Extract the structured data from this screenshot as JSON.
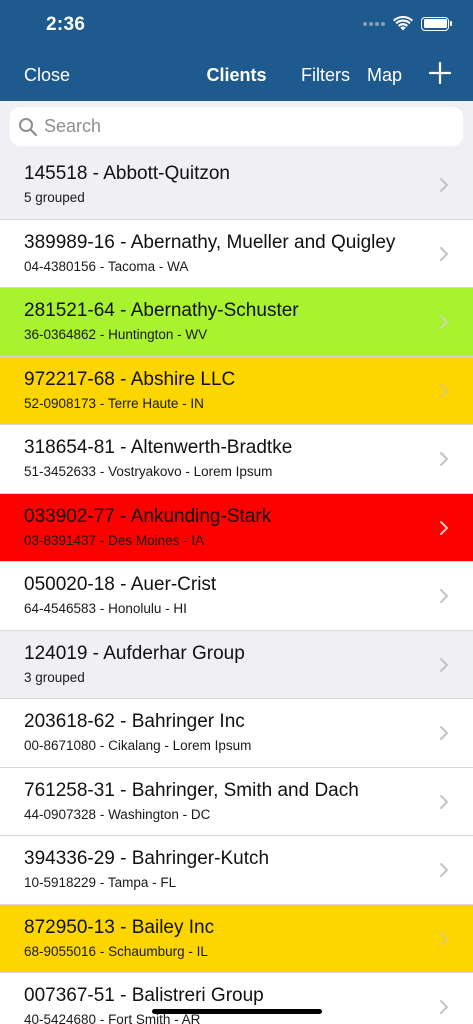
{
  "status_bar": {
    "time": "2:36"
  },
  "nav": {
    "close_label": "Close",
    "title": "Clients",
    "filters_label": "Filters",
    "map_label": "Map",
    "add_icon": "plus-icon"
  },
  "search": {
    "placeholder": "Search",
    "value": ""
  },
  "colors": {
    "header": "#1f5a8f",
    "grouped": "#efeff4",
    "default": "#ffffff",
    "green": "#a8f22f",
    "yellow": "#fdd600",
    "red": "#fd0000"
  },
  "clients": [
    {
      "title": "145518 - Abbott-Quitzon",
      "subtitle": "5 grouped",
      "color": "#efeff4",
      "chevron": "#c3c3c8"
    },
    {
      "title": "389989-16 - Abernathy, Mueller and Quigley",
      "subtitle": "04-4380156 - Tacoma - WA",
      "color": "#ffffff",
      "chevron": "#c3c3c8"
    },
    {
      "title": "281521-64 - Abernathy-Schuster",
      "subtitle": "36-0364862 - Huntington - WV",
      "color": "#a8f22f",
      "chevron": "#c9d8b0"
    },
    {
      "title": "972217-68 - Abshire LLC",
      "subtitle": "52-0908173 - Terre Haute - IN",
      "color": "#fdd600",
      "chevron": "#e2c870"
    },
    {
      "title": "318654-81 - Altenwerth-Bradtke",
      "subtitle": "51-3452633 - Vostryakovo - Lorem Ipsum",
      "color": "#ffffff",
      "chevron": "#c3c3c8"
    },
    {
      "title": "033902-77 - Ankunding-Stark",
      "subtitle": "03-8391437 - Des Moines - IA",
      "color": "#fd0000",
      "chevron": "#f2c2c2"
    },
    {
      "title": "050020-18 - Auer-Crist",
      "subtitle": "64-4546583 - Honolulu - HI",
      "color": "#ffffff",
      "chevron": "#c3c3c8"
    },
    {
      "title": "124019 - Aufderhar Group",
      "subtitle": "3 grouped",
      "color": "#efeff4",
      "chevron": "#c3c3c8"
    },
    {
      "title": "203618-62 - Bahringer Inc",
      "subtitle": "00-8671080 - Cikalang - Lorem Ipsum",
      "color": "#ffffff",
      "chevron": "#c3c3c8"
    },
    {
      "title": "761258-31 - Bahringer, Smith and Dach",
      "subtitle": "44-0907328 - Washington - DC",
      "color": "#ffffff",
      "chevron": "#c3c3c8"
    },
    {
      "title": "394336-29 - Bahringer-Kutch",
      "subtitle": "10-5918229 - Tampa - FL",
      "color": "#ffffff",
      "chevron": "#c3c3c8"
    },
    {
      "title": "872950-13 - Bailey Inc",
      "subtitle": "68-9055016 - Schaumburg - IL",
      "color": "#fdd600",
      "chevron": "#e2c870"
    },
    {
      "title": "007367-51 - Balistreri Group",
      "subtitle": "40-5424680 - Fort Smith - AR",
      "color": "#ffffff",
      "chevron": "#c3c3c8"
    }
  ]
}
